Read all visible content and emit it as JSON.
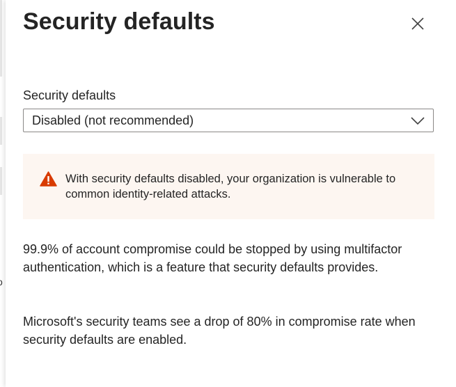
{
  "panel": {
    "title": "Security defaults",
    "close_icon": "close-icon"
  },
  "field": {
    "label": "Security defaults",
    "selected_value": "Disabled (not recommended)",
    "chevron_icon": "chevron-down-icon"
  },
  "warning": {
    "icon": "warning-icon",
    "color": "#d83b01",
    "background": "#fdf6f1",
    "text": "With security defaults disabled, your organization is vulnerable to common identity-related attacks."
  },
  "body": {
    "paragraph1": "99.9% of account compromise could be stopped by using multifactor authentication, which is a feature that security defaults provides.",
    "paragraph2": "Microsoft's security teams see a drop of 80% in compromise rate when security defaults are enabled."
  },
  "underlay": {
    "partial_text": "o"
  }
}
